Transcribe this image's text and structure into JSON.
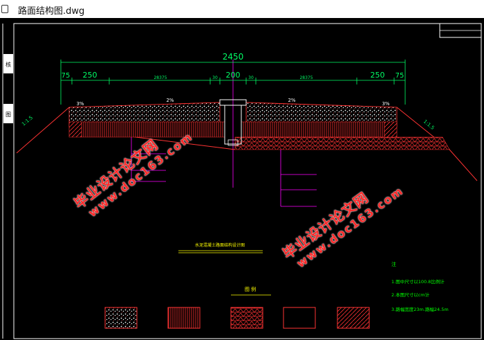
{
  "window": {
    "title": "路面结构图.dwg"
  },
  "drawing": {
    "dims": {
      "total": "2450",
      "left_outer_small": "75",
      "left_outer": "250",
      "left_inner": "28375",
      "left_small": "30",
      "center": "200",
      "right_small": "30",
      "right_inner": "28375",
      "right_outer": "250",
      "right_outer_small": "75"
    },
    "slopes": {
      "left_shoulder": "3%",
      "left_lane": "2%",
      "right_lane": "2%",
      "right_shoulder": "3%",
      "left_side": "1:1.5",
      "right_side": "1:1.5"
    },
    "note_title": "水泥混凝土路面结构设计图",
    "legend_title": "图 例",
    "notes": {
      "heading": "注",
      "items": [
        "1.图中尺寸以100.8比例计",
        "2.本图尺寸以cm计",
        "3.路幅宽度23m.路幅24.5m"
      ]
    },
    "colors": {
      "dimension": "#00ff66",
      "pavement": "#ffffff",
      "structure": "#ff3333",
      "label": "#ff00ff",
      "notes": "#00ff00"
    }
  },
  "watermark": {
    "cn": "毕业设计论文网",
    "url": "www.doc163.com"
  }
}
